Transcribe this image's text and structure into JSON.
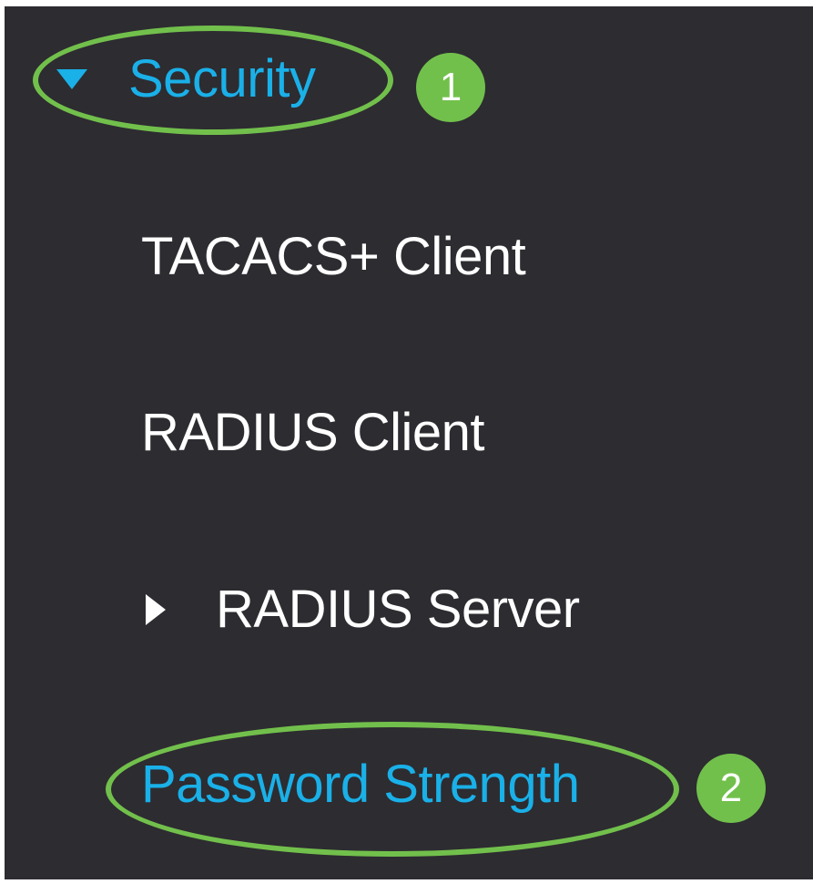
{
  "nav": {
    "security": {
      "label": "Security",
      "expanded": true,
      "icon": "caret-down-icon"
    },
    "tacacs_client": {
      "label": "TACACS+ Client"
    },
    "radius_client": {
      "label": "RADIUS Client"
    },
    "radius_server": {
      "label": "RADIUS Server",
      "expanded": false,
      "icon": "caret-right-icon"
    },
    "password_strength": {
      "label": "Password Strength"
    }
  },
  "annotations": {
    "step_1": "1",
    "step_2": "2"
  },
  "colors": {
    "panel_background": "#2d2c31",
    "link_blue": "#1ab0e8",
    "item_white": "#ffffff",
    "highlight_green": "#72c04c"
  }
}
